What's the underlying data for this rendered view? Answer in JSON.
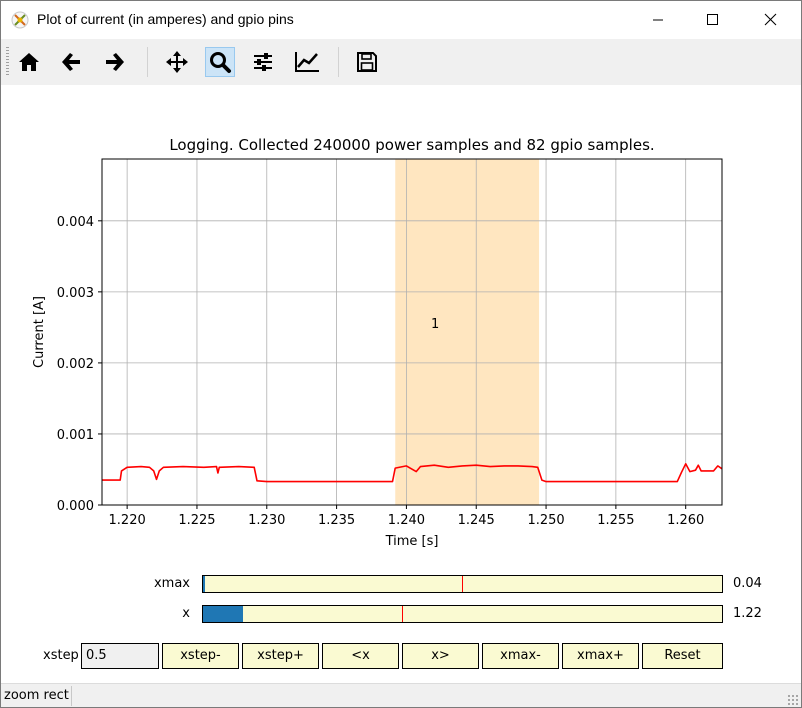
{
  "window": {
    "title": "Plot of current (in amperes) and gpio pins",
    "controls": [
      "minimize-icon",
      "maximize-icon",
      "close-icon"
    ]
  },
  "toolbar": {
    "buttons": [
      {
        "icon": "home-icon",
        "label": "Home"
      },
      {
        "icon": "back-arrow-icon",
        "label": "Back"
      },
      {
        "icon": "forward-arrow-icon",
        "label": "Forward"
      },
      {
        "icon": "pan-icon",
        "label": "Pan"
      },
      {
        "icon": "zoom-icon",
        "label": "Zoom",
        "active": true
      },
      {
        "icon": "subplots-icon",
        "label": "Subplots"
      },
      {
        "icon": "axes-icon",
        "label": "Customize"
      },
      {
        "icon": "save-icon",
        "label": "Save"
      }
    ]
  },
  "chart_data": {
    "type": "line",
    "title": "Logging. Collected 240000 power samples and 82 gpio samples.",
    "xlabel": "Time [s]",
    "ylabel": "Current [A]",
    "xlim": [
      1.2182,
      1.2626
    ],
    "ylim": [
      0.0,
      0.00487
    ],
    "xticks": [
      "1.220",
      "1.225",
      "1.230",
      "1.235",
      "1.240",
      "1.245",
      "1.250",
      "1.255",
      "1.260"
    ],
    "yticks": [
      "0.000",
      "0.001",
      "0.002",
      "0.003",
      "0.004"
    ],
    "grid": true,
    "line_color": "#ff0000",
    "highlight": {
      "x": [
        1.2392,
        1.2495
      ],
      "color": "#ffe6c0",
      "label": "1"
    },
    "series": [
      {
        "values": [
          [
            1.2182,
            0.00035
          ],
          [
            1.2195,
            0.00035
          ],
          [
            1.2196,
            0.00048
          ],
          [
            1.22,
            0.00053
          ],
          [
            1.221,
            0.00054
          ],
          [
            1.2216,
            0.00053
          ],
          [
            1.2219,
            0.00048
          ],
          [
            1.2221,
            0.00036
          ],
          [
            1.2223,
            0.00048
          ],
          [
            1.2226,
            0.00053
          ],
          [
            1.224,
            0.00054
          ],
          [
            1.2255,
            0.00053
          ],
          [
            1.2264,
            0.00054
          ],
          [
            1.2265,
            0.00045
          ],
          [
            1.2266,
            0.00053
          ],
          [
            1.228,
            0.00054
          ],
          [
            1.2291,
            0.00053
          ],
          [
            1.2293,
            0.00034
          ],
          [
            1.23,
            0.00033
          ],
          [
            1.235,
            0.00033
          ],
          [
            1.239,
            0.00033
          ],
          [
            1.2392,
            0.00052
          ],
          [
            1.24,
            0.00055
          ],
          [
            1.2407,
            0.00047
          ],
          [
            1.241,
            0.00054
          ],
          [
            1.242,
            0.00056
          ],
          [
            1.243,
            0.00053
          ],
          [
            1.244,
            0.00055
          ],
          [
            1.245,
            0.00056
          ],
          [
            1.246,
            0.00054
          ],
          [
            1.247,
            0.00055
          ],
          [
            1.248,
            0.00055
          ],
          [
            1.249,
            0.00054
          ],
          [
            1.2494,
            0.00053
          ],
          [
            1.2497,
            0.00035
          ],
          [
            1.25,
            0.00033
          ],
          [
            1.255,
            0.00033
          ],
          [
            1.2594,
            0.00033
          ],
          [
            1.2597,
            0.00046
          ],
          [
            1.26,
            0.00058
          ],
          [
            1.2603,
            0.00047
          ],
          [
            1.2607,
            0.00049
          ],
          [
            1.2609,
            0.00056
          ],
          [
            1.2611,
            0.00048
          ],
          [
            1.262,
            0.00048
          ],
          [
            1.2623,
            0.00055
          ],
          [
            1.2626,
            0.00051
          ]
        ]
      }
    ]
  },
  "sliders": [
    {
      "label": "xmax",
      "value_text": "0.04",
      "fill": 0.0,
      "marker": 0.5
    },
    {
      "label": "x",
      "value_text": "1.22",
      "fill": 0.078,
      "marker": 0.38
    }
  ],
  "controls": {
    "xstep_label": "xstep",
    "xstep_value": "0.5",
    "buttons": [
      "xstep-",
      "xstep+",
      "<x",
      "x>",
      "xmax-",
      "xmax+",
      "Reset"
    ]
  },
  "status": {
    "text": "zoom rect"
  }
}
